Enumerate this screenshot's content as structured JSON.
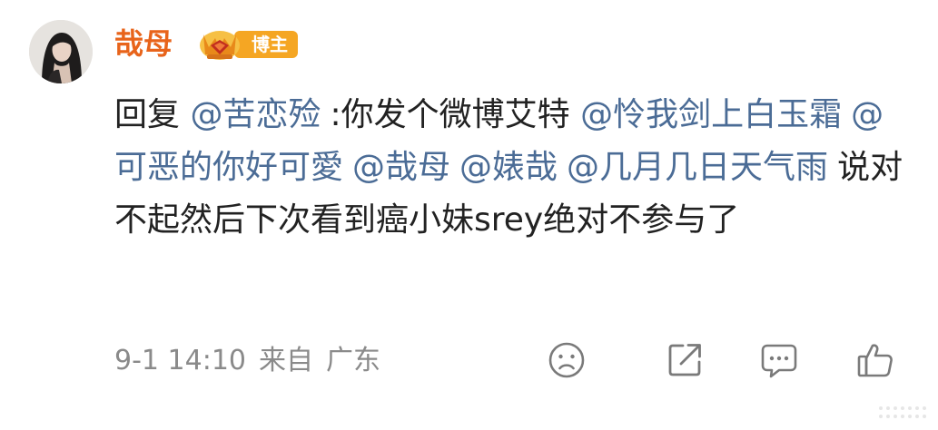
{
  "post": {
    "author": {
      "name": "哉母",
      "badge_label": "博主"
    },
    "body": {
      "reply_prefix": "回复",
      "reply_to": "@苦恋殓",
      "colon_text": ":你发个微博艾特",
      "mentions": [
        "@怜我剑上白玉霜",
        "@可恶的你好可愛",
        "@哉母",
        "@婊哉",
        "@几月几日天气雨"
      ],
      "tail_text": "说对不起然后下次看到癌小妹srey绝对不参与了"
    },
    "meta": {
      "time": "9-1 14:10",
      "source_label": "来自",
      "location": "广东"
    },
    "actions": {
      "dislike_icon": "sad-face-icon",
      "share_icon": "share-icon",
      "comment_icon": "comment-bubble-icon",
      "like_icon": "thumbs-up-icon"
    }
  },
  "colors": {
    "username": "#e8641b",
    "mention": "#4b6c96",
    "body_text": "#222222",
    "meta_text": "#8a8a8a",
    "badge_bg": "#f5a623",
    "icon_stroke": "#7a7a7a"
  }
}
